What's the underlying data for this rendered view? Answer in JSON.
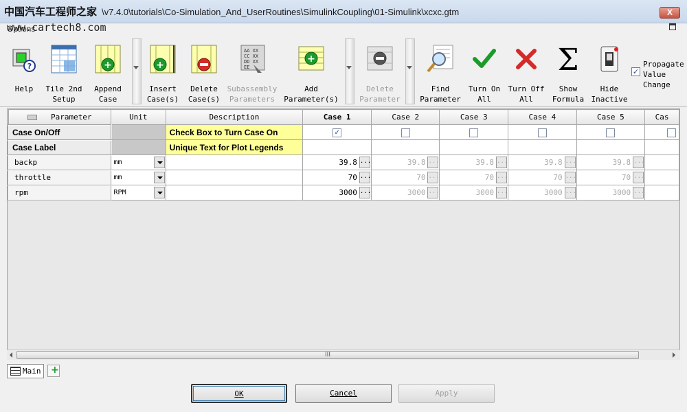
{
  "window": {
    "title_path": "\\v7.4.0\\tutorials\\Co-Simulation_And_UserRoutines\\SimulinkCoupling\\01-Simulink\\xcxc.gtm",
    "watermark_cn": "中国汽车工程师之家",
    "watermark_url": "www.cartech8.com",
    "menu_options": "Options",
    "close": "X"
  },
  "toolbar": {
    "buttons": [
      {
        "label": "Help",
        "icon": "help-icon"
      },
      {
        "label": "Tile 2nd\nSetup",
        "icon": "tile-setup-icon"
      },
      {
        "label": "Append\nCase",
        "icon": "append-case-icon"
      },
      {
        "label": "Insert\nCase(s)",
        "icon": "insert-case-icon"
      },
      {
        "label": "Delete\nCase(s)",
        "icon": "delete-case-icon"
      },
      {
        "label": "Subassembly\nParameters",
        "icon": "subassembly-icon",
        "disabled": true
      },
      {
        "label": "Add\nParameter(s)",
        "icon": "add-parameter-icon"
      },
      {
        "label": "Delete\nParameter",
        "icon": "delete-parameter-icon",
        "disabled": true
      },
      {
        "label": "Find\nParameter",
        "icon": "find-parameter-icon"
      },
      {
        "label": "Turn On\nAll",
        "icon": "checkmark-icon"
      },
      {
        "label": "Turn Off\nAll",
        "icon": "x-mark-icon"
      },
      {
        "label": "Show\nFormula",
        "icon": "sigma-icon"
      },
      {
        "label": "Hide\nInactive",
        "icon": "switch-icon"
      }
    ],
    "propagate_label": "Propagate\nValue\nChange",
    "propagate_checked": true
  },
  "grid": {
    "headers": [
      "Parameter",
      "Unit",
      "Description",
      "Case 1",
      "Case 2",
      "Case 3",
      "Case 4",
      "Case 5",
      "Cas"
    ],
    "case_on_off": {
      "label": "Case On/Off",
      "description": "Check Box to Turn Case On",
      "checked": [
        true,
        false,
        false,
        false,
        false,
        false
      ]
    },
    "case_label": {
      "label": "Case Label",
      "description": "Unique Text for Plot Legends"
    },
    "rows": [
      {
        "name": "backp",
        "unit": "mm",
        "values": [
          "39.8",
          "39.8",
          "39.8",
          "39.8",
          "39.8"
        ]
      },
      {
        "name": "throttle",
        "unit": "mm",
        "values": [
          "70",
          "70",
          "70",
          "70",
          "70"
        ]
      },
      {
        "name": "rpm",
        "unit": "RPM",
        "values": [
          "3000",
          "3000",
          "3000",
          "3000",
          "3000"
        ]
      }
    ],
    "scroll_grip": "III"
  },
  "tabs": {
    "main": "Main"
  },
  "dialog": {
    "ok": "OK",
    "cancel": "Cancel",
    "apply": "Apply"
  },
  "colors": {
    "description_highlight": "#ffff99",
    "check_green": "#1c9b2a",
    "delete_red": "#d42a2a"
  }
}
